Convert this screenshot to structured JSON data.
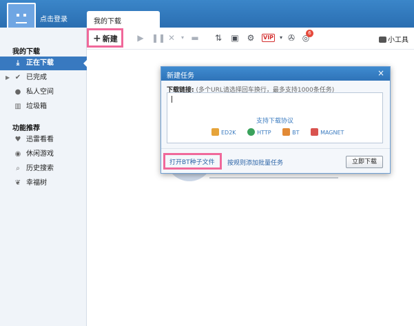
{
  "header": {
    "login_text": "点击登录",
    "tab_label": "我的下载"
  },
  "sidebar": {
    "section1_title": "我的下载",
    "items": [
      {
        "label": "正在下载",
        "icon": "download-icon"
      },
      {
        "label": "已完成",
        "icon": "check-icon"
      },
      {
        "label": "私人空间",
        "icon": "user-icon"
      },
      {
        "label": "垃圾箱",
        "icon": "trash-icon"
      }
    ],
    "section2_title": "功能推荐",
    "items2": [
      {
        "label": "迅雷看看",
        "icon": "heart-icon"
      },
      {
        "label": "休闲游戏",
        "icon": "gamepad-icon"
      },
      {
        "label": "历史搜索",
        "icon": "search-icon"
      },
      {
        "label": "幸福树",
        "icon": "leaf-icon"
      }
    ]
  },
  "toolbar": {
    "new_label": "新建",
    "vip_label": "VIP",
    "badge_count": "6",
    "tools_label": "小工具"
  },
  "dialog": {
    "title": "新建任务",
    "link_label": "下载链接:",
    "link_hint": "(多个URL请选择回车换行，最多支持1000条任务)",
    "url_value": "",
    "protocols_title": "支持下载协议",
    "protocols": [
      "ED2K",
      "HTTP",
      "BT",
      "MAGNET"
    ],
    "bt_link": "打开BT种子文件",
    "batch_link": "按规则添加批量任务",
    "download_button": "立即下载"
  },
  "colors": {
    "accent_blue": "#3879c0",
    "highlight_pink": "#f0689a",
    "header_blue": "#2f73b8"
  }
}
